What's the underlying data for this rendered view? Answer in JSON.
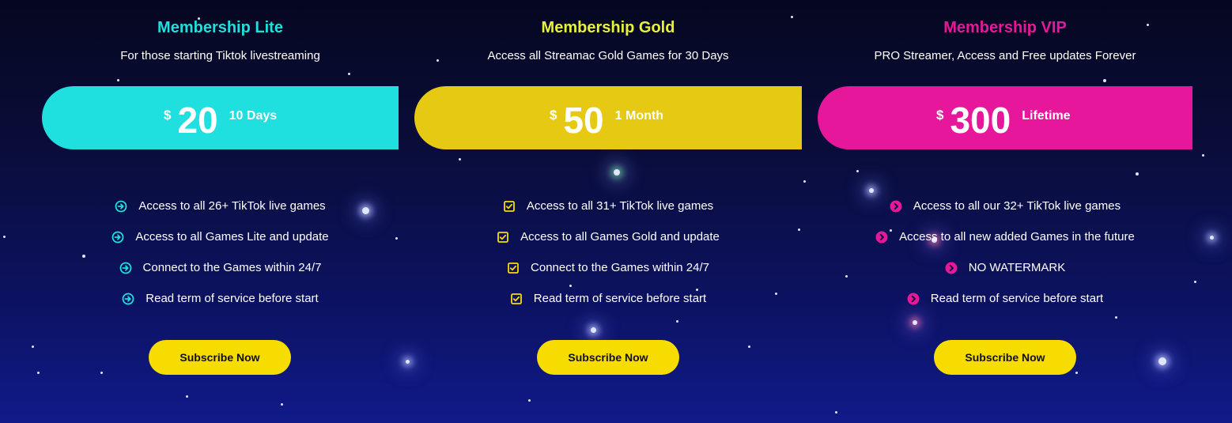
{
  "colors": {
    "lite": "#1fdfdf",
    "gold": "#e5c912",
    "gold_title": "#e8f23a",
    "vip": "#e6179a",
    "button": "#f7dc00"
  },
  "plans": [
    {
      "title": "Membership Lite",
      "subtitle": "For those starting Tiktok livestreaming",
      "currency": "$",
      "price": "20",
      "period": "10 Days",
      "icon": "arrow-circle-right-icon",
      "features": [
        "Access to all 26+ TikTok live games",
        "Access to all Games Lite and update",
        "Connect to the Games within 24/7",
        "Read term of service before start"
      ],
      "button": "Subscribe Now"
    },
    {
      "title": "Membership Gold",
      "subtitle": "Access all Streamac Gold Games for 30 Days",
      "currency": "$",
      "price": "50",
      "period": "1 Month",
      "icon": "checkbox-checked-icon",
      "features": [
        "Access to all 31+ TikTok live games",
        "Access to all Games Gold and update",
        "Connect to the Games within 24/7",
        "Read term of service before start"
      ],
      "button": "Subscribe Now"
    },
    {
      "title": "Membership VIP",
      "subtitle": "PRO Streamer, Access and Free updates Forever",
      "currency": "$",
      "price": "300",
      "period": "Lifetime",
      "icon": "chevron-circle-right-icon",
      "features": [
        "Access to all our 32+ TikTok live games",
        "Access to all new added Games in the future",
        "NO WATERMARK",
        "Read term of service before start"
      ],
      "button": "Subscribe Now"
    }
  ]
}
